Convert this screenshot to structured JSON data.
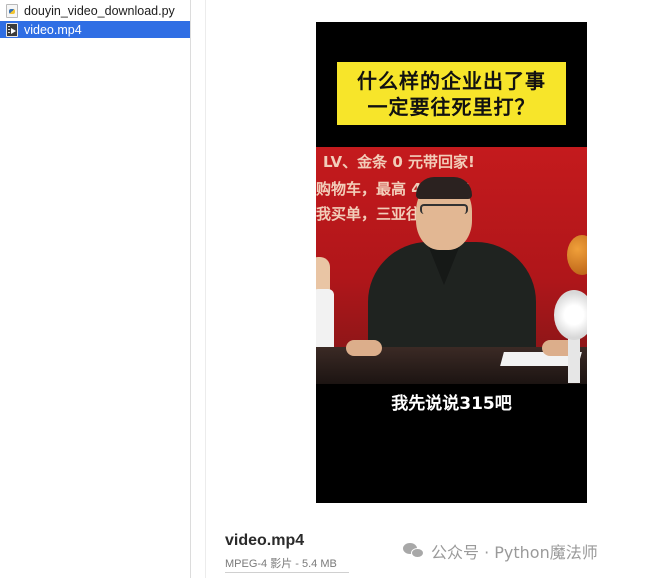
{
  "files": [
    {
      "name": "douyin_video_download.py",
      "icon": "python-file-icon",
      "selected": false
    },
    {
      "name": "video.mp4",
      "icon": "video-file-icon",
      "selected": true
    }
  ],
  "preview": {
    "title_line1": "什么样的企业出了事",
    "title_line2": "一定要往死里打？",
    "banner_line1": "LV、金条 0 元带回家!",
    "banner_line2": "购物车，最高 49999!",
    "banner_line3": "我买单，三亚往",
    "subtitle": "我先说说315吧"
  },
  "info": {
    "file_name": "video.mp4",
    "file_meta": "MPEG-4 影片 - 5.4 MB"
  },
  "watermark": {
    "text": "公众号 · Python魔法师"
  },
  "colors": {
    "selection": "#2f6ee4",
    "title_bg": "#f7e52a",
    "scene_red": "#c41a1d"
  }
}
